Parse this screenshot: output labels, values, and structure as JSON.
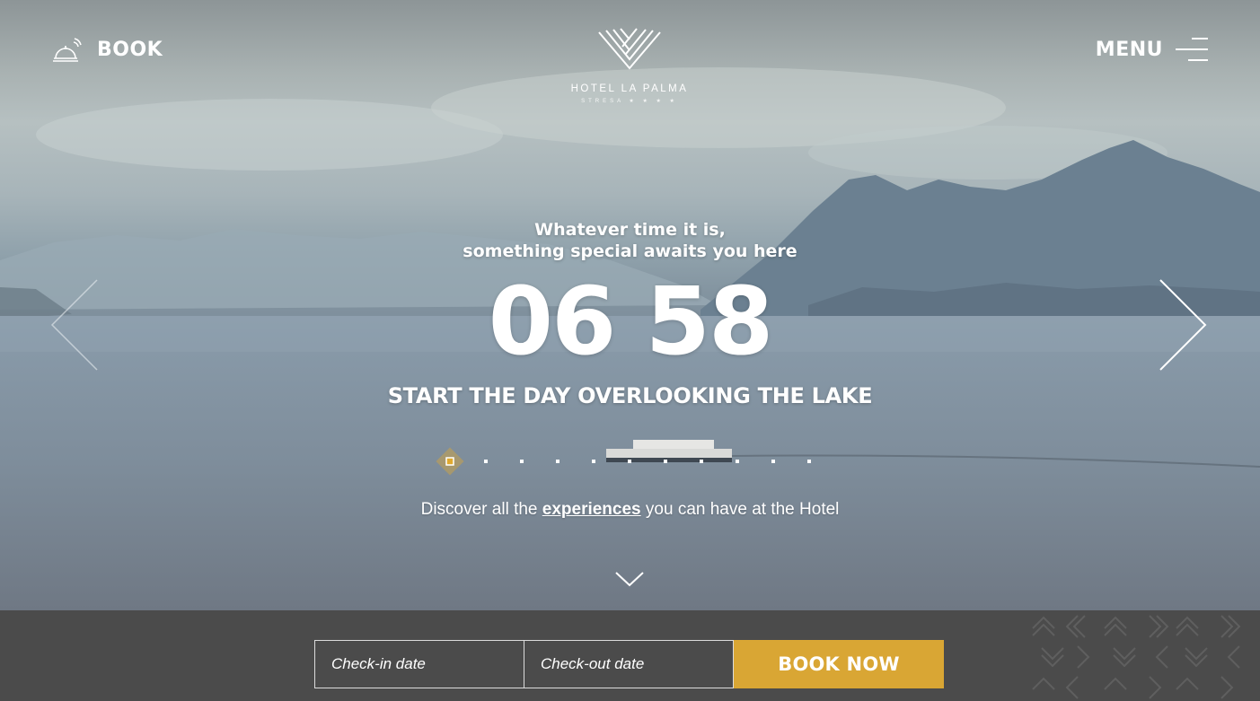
{
  "header": {
    "book_label": "BOOK",
    "menu_label": "MENU",
    "logo": {
      "name": "HOTEL LA PALMA",
      "sub": "STRESA ★ ★ ★ ★"
    }
  },
  "hero": {
    "tagline_line1": "Whatever time it is,",
    "tagline_line2": "something special awaits you here",
    "clock": "06 58",
    "headline": "START THE DAY OVERLOOKING THE LAKE",
    "discover_before": "Discover all the ",
    "discover_link": "experiences",
    "discover_after": " you can have at the Hotel",
    "slides": {
      "count": 11,
      "active": 1
    }
  },
  "booking": {
    "checkin_placeholder": "Check-in date",
    "checkout_placeholder": "Check-out date",
    "book_now_label": "BOOK NOW"
  },
  "colors": {
    "accent": "#d9a634",
    "bar_background": "#4b4b4b",
    "text": "#ffffff"
  },
  "icons": [
    "bell-icon",
    "palm-logo-icon",
    "hamburger-icon",
    "chevron-left-icon",
    "chevron-right-icon",
    "chevron-down-icon"
  ]
}
